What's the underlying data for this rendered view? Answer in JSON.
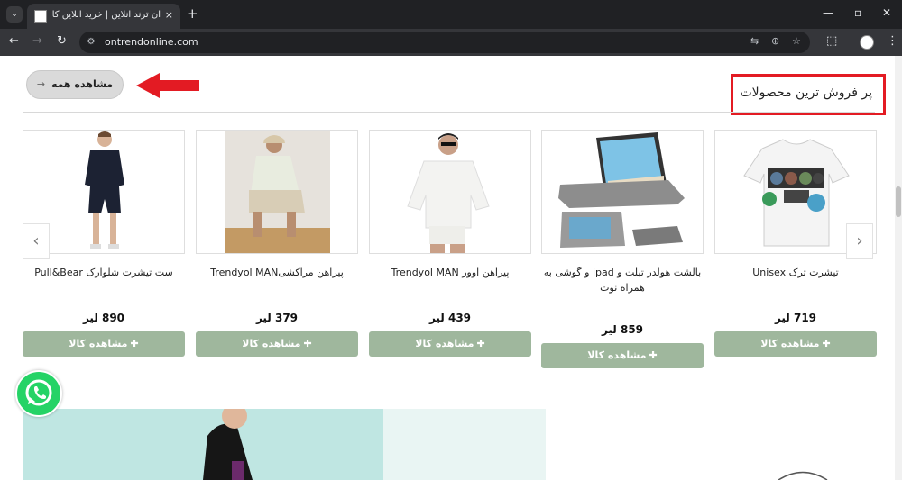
{
  "browser": {
    "tab_title": "آن ترند آنلاین | خرید آنلاین کالا از ترکیه",
    "tab_close": "×",
    "new_tab": "+",
    "url": "ontrendonline.com",
    "window_controls": {
      "minimize": "—",
      "maximize": "▫",
      "close": "✕"
    }
  },
  "section": {
    "title": "پر فروش ترین محصولات",
    "see_all_label": "مشاهده همه",
    "see_all_arrow": "→",
    "highlight_color": "#e31b23"
  },
  "carousel": {
    "prev": "‹",
    "next": "›"
  },
  "products": [
    {
      "name": "تیشرت ترک Unisex",
      "price": "719 لیر",
      "button": "مشاهده کالا",
      "icon": "tshirt-print-image"
    },
    {
      "name": "بالشت هولدر تبلت و ipad و گوشی به همراه نوت",
      "price": "859 لیر",
      "button": "مشاهده کالا",
      "icon": "tablet-pillow-image"
    },
    {
      "name": "پیراهن اوور Trendyol MAN",
      "price": "439 لیر",
      "button": "مشاهده کالا",
      "icon": "oversize-shirt-man-image"
    },
    {
      "name": "پیراهن مراکشیTrendyol MAN",
      "price": "379 لیر",
      "button": "مشاهده کالا",
      "icon": "moroccan-shirt-man-image"
    },
    {
      "name": "ست تیشرت شلوارک Pull&Bear",
      "price": "890 لیر",
      "button": "مشاهده کالا",
      "icon": "tshirt-shorts-set-image"
    }
  ],
  "colors": {
    "button_green": "#9fb79d",
    "banner_teal": "#bfe6e2",
    "whatsapp": "#25d366"
  },
  "plus_glyph": "✚"
}
